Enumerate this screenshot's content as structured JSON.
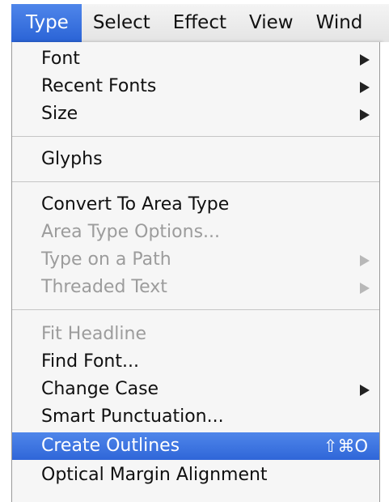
{
  "menubar": {
    "items": [
      {
        "label": "Type"
      },
      {
        "label": "Select"
      },
      {
        "label": "Effect"
      },
      {
        "label": "View"
      },
      {
        "label": "Wind"
      }
    ]
  },
  "menu": {
    "font": "Font",
    "recent_fonts": "Recent Fonts",
    "size": "Size",
    "glyphs": "Glyphs",
    "convert_to_area_type": "Convert To Area Type",
    "area_type_options": "Area Type Options...",
    "type_on_a_path": "Type on a Path",
    "threaded_text": "Threaded Text",
    "fit_headline": "Fit Headline",
    "find_font": "Find Font...",
    "change_case": "Change Case",
    "smart_punctuation": "Smart Punctuation...",
    "create_outlines": "Create Outlines",
    "create_outlines_shortcut": "⇧⌘O",
    "optical_margin_alignment": "Optical Margin Alignment"
  },
  "colors": {
    "highlight": "#3a72e0",
    "disabled_text": "#9c9c9c"
  }
}
